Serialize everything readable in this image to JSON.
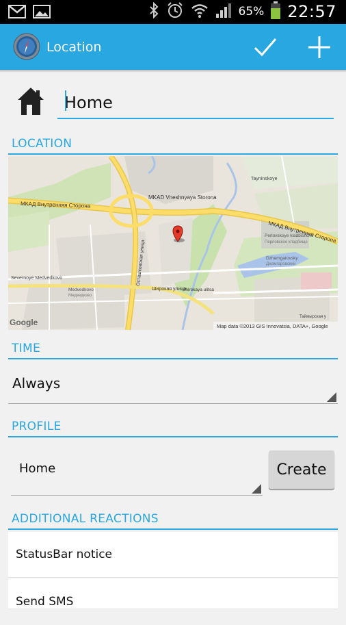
{
  "status_bar": {
    "battery_percent": "65%",
    "time": "22:57",
    "icons": [
      "gmail-icon",
      "gallery-icon",
      "bluetooth-icon",
      "alarm-icon",
      "wifi-icon",
      "signal-icon",
      "battery-icon"
    ]
  },
  "action_bar": {
    "title": "Location",
    "accent_color": "#29a7e1",
    "actions": [
      "check-icon",
      "plus-icon"
    ]
  },
  "name_field": {
    "value": "Home",
    "icon": "home-icon"
  },
  "sections": {
    "location": "LOCATION",
    "time": "TIME",
    "profile": "PROFILE",
    "additional_reactions": "ADDITIONAL REACTIONS"
  },
  "map": {
    "labels": {
      "mkad_west": "МКАД Внутренняя Сторона",
      "mkad_center": "MKAD Vneshnyaya Storona",
      "mkad_east": "МКАД Внутренняя Сторона",
      "tayninskoye": "Tayninskoye",
      "perlovskoye_en": "Perlovskoye kladbishche",
      "perlovskoye_ru": "Перловское кладбище",
      "dzhamgarovsky_en": "Dzhamgarovsky",
      "dzhamgarovsky_ru": "Джамгаровский",
      "severnoye_en": "Severnoye Medvedkovo",
      "medvedkovo_en": "Medvedkovo",
      "medvedkovo_ru": "Медведково",
      "shirokaya": "Широкая улица",
      "shirokaya_en": "Shirokaya ulitsa",
      "ostashkovskaya": "Осташковская улица",
      "google_logo": "Google",
      "attribution": "Map data ©2013 GIS Innovatsia, DATA+, Google",
      "taimyrskaya": "Таймырская у"
    }
  },
  "time": {
    "selected": "Always"
  },
  "profile": {
    "selected": "Home",
    "create_label": "Create"
  },
  "reactions": [
    {
      "label": "StatusBar notice"
    },
    {
      "label": "Send SMS"
    }
  ]
}
